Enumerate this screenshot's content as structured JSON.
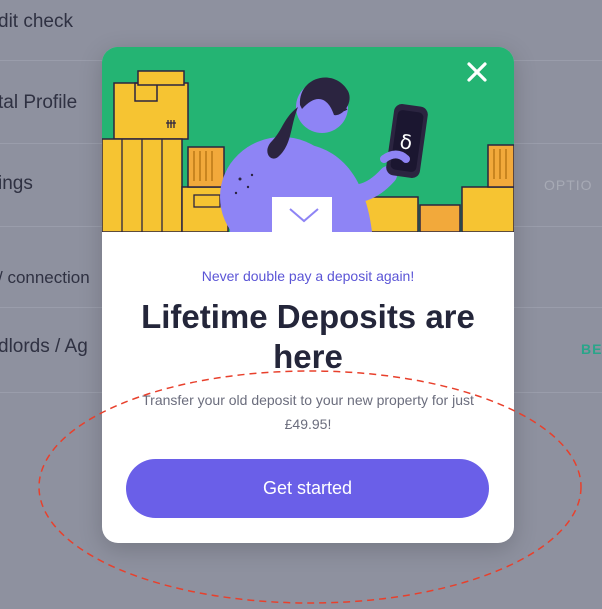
{
  "background": {
    "rows": [
      {
        "label": "dit check"
      },
      {
        "label": "tal Profile"
      },
      {
        "label": "ings",
        "tag": "OPTIO"
      },
      {
        "label": "/ connection"
      },
      {
        "label": "dlords / Ag",
        "tag": "BE"
      }
    ]
  },
  "modal": {
    "close_icon": "close-icon",
    "tagline": "Never double pay a deposit again!",
    "headline": "Lifetime Deposits are here",
    "body": "Transfer your old deposit to your new property for just £49.95!",
    "cta_label": "Get started",
    "app_logo_glyph": "δ"
  },
  "colors": {
    "overlay": "#8e919f",
    "hero_green": "#24b473",
    "accent_purple": "#6a5fe8",
    "tag_gray": "#a7aab5",
    "tag_teal": "#2aa58a",
    "annotation_red": "#e8402c"
  }
}
